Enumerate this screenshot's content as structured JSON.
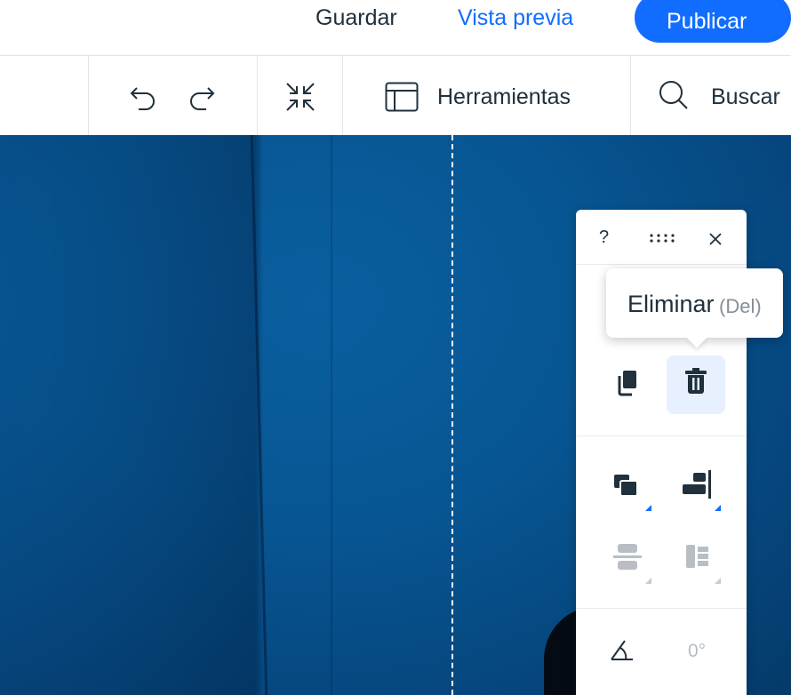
{
  "topbar": {
    "save_label": "Guardar",
    "preview_label": "Vista previa",
    "publish_label": "Publicar"
  },
  "toolbar": {
    "undo_icon": "undo-icon",
    "redo_icon": "redo-icon",
    "zoom_out_icon": "zoom-out-icon",
    "tools_icon": "tools-panel-icon",
    "tools_label": "Herramientas",
    "search_icon": "search-icon",
    "search_label": "Buscar"
  },
  "panel": {
    "help_label": "?",
    "drag_icon": "drag-handle-icon",
    "close_icon": "close-icon",
    "duplicate_icon": "duplicate-icon",
    "delete_icon": "delete-icon",
    "arrange_icon": "arrange-icon",
    "align_icon": "align-icon",
    "distribute_icon": "distribute-icon",
    "match_size_icon": "match-size-icon",
    "rotate_icon": "rotate-icon",
    "rotation_value": "0°"
  },
  "tooltip": {
    "label": "Eliminar",
    "shortcut": "(Del)"
  },
  "colors": {
    "accent": "#116dff",
    "canvas": "#075693",
    "text": "#20303c"
  }
}
